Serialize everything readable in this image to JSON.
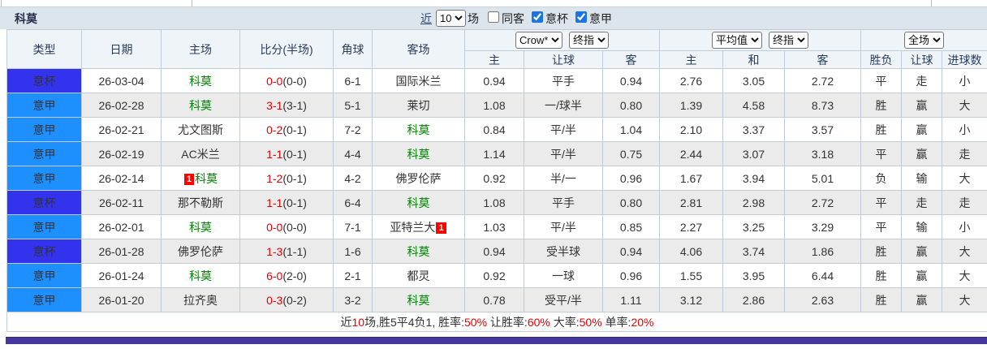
{
  "header": {
    "team": "科莫",
    "recent_label": "近",
    "count_select": {
      "options": [
        "10"
      ],
      "value": "10"
    },
    "matches_label": "场",
    "checkboxes": [
      {
        "label": "同客",
        "checked": false
      },
      {
        "label": "意杯",
        "checked": true
      },
      {
        "label": "意甲",
        "checked": true
      }
    ]
  },
  "table": {
    "columns": {
      "type": "类型",
      "date": "日期",
      "home": "主场",
      "score": "比分(半场)",
      "corner": "角球",
      "away": "客场",
      "odds_home": "主",
      "odds_handicap": "让球",
      "odds_away": "客",
      "euro_home": "主",
      "euro_draw": "和",
      "euro_away": "客",
      "result_wdl": "胜负",
      "result_handicap": "让球",
      "result_goals": "进球数"
    },
    "selects": {
      "bookmaker": {
        "options": [
          "Crow*"
        ],
        "value": "Crow*"
      },
      "crown_stage": {
        "options": [
          "终指"
        ],
        "value": "终指"
      },
      "euro_avg": {
        "options": [
          "平均值"
        ],
        "value": "平均值"
      },
      "euro_stage": {
        "options": [
          "终指"
        ],
        "value": "终指"
      },
      "scope": {
        "options": [
          "全场"
        ],
        "value": "全场"
      }
    },
    "rows": [
      {
        "league": "意杯",
        "date": "26-03-04",
        "home": "科莫",
        "home_is_como": true,
        "home_card": false,
        "score_ft": "0-0",
        "score_ht": "(0-0)",
        "corners": "6-1",
        "away": "国际米兰",
        "away_is_como": false,
        "away_card": false,
        "crown_home": "0.94",
        "handicap": "平手",
        "crown_away": "0.94",
        "euro_home": "2.76",
        "euro_draw": "3.05",
        "euro_away": "2.72",
        "res_wdl": "平",
        "res_handicap": "走",
        "res_goals": "小"
      },
      {
        "league": "意甲",
        "date": "26-02-28",
        "home": "科莫",
        "home_is_como": true,
        "home_card": false,
        "score_ft": "3-1",
        "score_ht": "(3-1)",
        "corners": "5-1",
        "away": "莱切",
        "away_is_como": false,
        "away_card": false,
        "crown_home": "1.08",
        "handicap": "一/球半",
        "crown_away": "0.80",
        "euro_home": "1.39",
        "euro_draw": "4.58",
        "euro_away": "8.73",
        "res_wdl": "胜",
        "res_handicap": "赢",
        "res_goals": "大"
      },
      {
        "league": "意甲",
        "date": "26-02-21",
        "home": "尤文图斯",
        "home_is_como": false,
        "home_card": false,
        "score_ft": "0-2",
        "score_ht": "(0-1)",
        "corners": "7-2",
        "away": "科莫",
        "away_is_como": true,
        "away_card": false,
        "crown_home": "0.84",
        "handicap": "平/半",
        "crown_away": "1.04",
        "euro_home": "2.10",
        "euro_draw": "3.37",
        "euro_away": "3.57",
        "res_wdl": "胜",
        "res_handicap": "赢",
        "res_goals": "小"
      },
      {
        "league": "意甲",
        "date": "26-02-19",
        "home": "AC米兰",
        "home_is_como": false,
        "home_card": false,
        "score_ft": "1-1",
        "score_ht": "(0-1)",
        "corners": "4-4",
        "away": "科莫",
        "away_is_como": true,
        "away_card": false,
        "crown_home": "1.14",
        "handicap": "平/半",
        "crown_away": "0.75",
        "euro_home": "2.44",
        "euro_draw": "3.07",
        "euro_away": "3.18",
        "res_wdl": "平",
        "res_handicap": "赢",
        "res_goals": "走"
      },
      {
        "league": "意甲",
        "date": "26-02-14",
        "home": "科莫",
        "home_is_como": true,
        "home_card": true,
        "score_ft": "1-2",
        "score_ht": "(0-1)",
        "corners": "4-2",
        "away": "佛罗伦萨",
        "away_is_como": false,
        "away_card": false,
        "crown_home": "0.92",
        "handicap": "半/一",
        "crown_away": "0.96",
        "euro_home": "1.67",
        "euro_draw": "3.94",
        "euro_away": "5.01",
        "res_wdl": "负",
        "res_handicap": "输",
        "res_goals": "大"
      },
      {
        "league": "意杯",
        "date": "26-02-11",
        "home": "那不勒斯",
        "home_is_como": false,
        "home_card": false,
        "score_ft": "1-1",
        "score_ht": "(0-1)",
        "corners": "6-4",
        "away": "科莫",
        "away_is_como": true,
        "away_card": false,
        "crown_home": "1.08",
        "handicap": "平手",
        "crown_away": "0.80",
        "euro_home": "2.81",
        "euro_draw": "2.98",
        "euro_away": "2.72",
        "res_wdl": "平",
        "res_handicap": "走",
        "res_goals": "走"
      },
      {
        "league": "意甲",
        "date": "26-02-01",
        "home": "科莫",
        "home_is_como": true,
        "home_card": false,
        "score_ft": "0-0",
        "score_ht": "(0-0)",
        "corners": "7-1",
        "away": "亚特兰大",
        "away_is_como": false,
        "away_card": true,
        "crown_home": "1.03",
        "handicap": "平/半",
        "crown_away": "0.85",
        "euro_home": "2.27",
        "euro_draw": "3.25",
        "euro_away": "3.29",
        "res_wdl": "平",
        "res_handicap": "输",
        "res_goals": "小"
      },
      {
        "league": "意杯",
        "date": "26-01-28",
        "home": "佛罗伦萨",
        "home_is_como": false,
        "home_card": false,
        "score_ft": "1-3",
        "score_ht": "(1-1)",
        "corners": "1-6",
        "away": "科莫",
        "away_is_como": true,
        "away_card": false,
        "crown_home": "0.94",
        "handicap": "受半球",
        "crown_away": "0.94",
        "euro_home": "4.06",
        "euro_draw": "3.74",
        "euro_away": "1.86",
        "res_wdl": "胜",
        "res_handicap": "赢",
        "res_goals": "大"
      },
      {
        "league": "意甲",
        "date": "26-01-24",
        "home": "科莫",
        "home_is_como": true,
        "home_card": false,
        "score_ft": "6-0",
        "score_ht": "(2-0)",
        "corners": "2-1",
        "away": "都灵",
        "away_is_como": false,
        "away_card": false,
        "crown_home": "0.92",
        "handicap": "一球",
        "crown_away": "0.96",
        "euro_home": "1.55",
        "euro_draw": "3.95",
        "euro_away": "6.44",
        "res_wdl": "胜",
        "res_handicap": "赢",
        "res_goals": "大"
      },
      {
        "league": "意甲",
        "date": "26-01-20",
        "home": "拉齐奥",
        "home_is_como": false,
        "home_card": false,
        "score_ft": "0-3",
        "score_ht": "(0-2)",
        "corners": "3-2",
        "away": "科莫",
        "away_is_como": true,
        "away_card": false,
        "crown_home": "0.78",
        "handicap": "受平/半",
        "crown_away": "1.11",
        "euro_home": "3.12",
        "euro_draw": "2.86",
        "euro_away": "2.63",
        "res_wdl": "胜",
        "res_handicap": "赢",
        "res_goals": "大"
      }
    ],
    "summary_segments": [
      {
        "text": "近",
        "red": false
      },
      {
        "text": "10",
        "red": true
      },
      {
        "text": "场,胜5平4负1, 胜率:",
        "red": false
      },
      {
        "text": "50%",
        "red": true
      },
      {
        "text": " 让胜率:",
        "red": false
      },
      {
        "text": "60%",
        "red": true
      },
      {
        "text": " 大率:",
        "red": false
      },
      {
        "text": "50%",
        "red": true
      },
      {
        "text": " 单率:",
        "red": false
      },
      {
        "text": "20%",
        "red": true
      }
    ]
  },
  "colors": {
    "league": {
      "意杯": "#3333ee",
      "意甲": "#1e8fff"
    },
    "result_red": "#e80000",
    "result_green": "#008500",
    "result_blue": "#2222dd",
    "score_red": "#e80000",
    "como_green": "#008500",
    "crown_col_bg": "#fbf3ea",
    "euro_col_bg": "#e9f3f9",
    "bottom_bar": "#44379e"
  }
}
